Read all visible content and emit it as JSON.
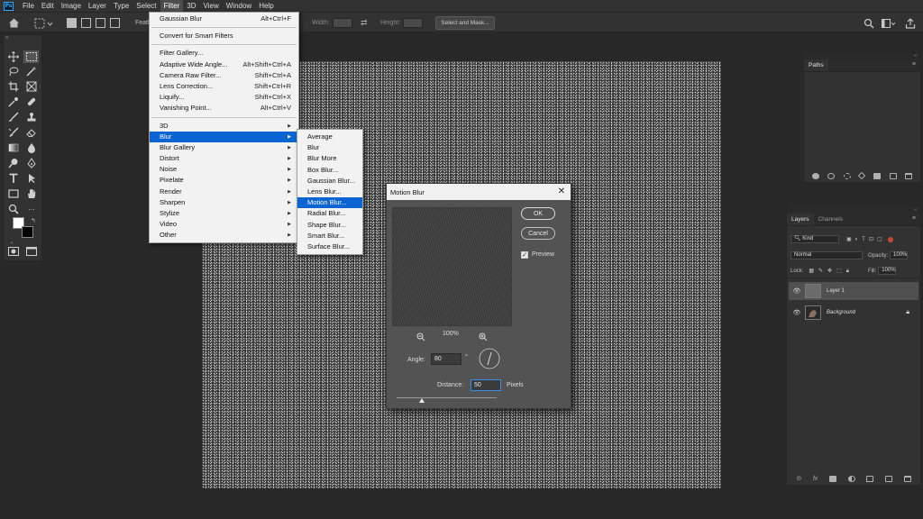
{
  "menubar": {
    "items": [
      "File",
      "Edit",
      "Image",
      "Layer",
      "Type",
      "Select",
      "Filter",
      "3D",
      "View",
      "Window",
      "Help"
    ],
    "active": "Filter",
    "logo_text": "Ps"
  },
  "options_bar": {
    "feather_label": "Feath",
    "width_label": "Width:",
    "height_label": "Height:",
    "select_mask_label": "Select and Mask..."
  },
  "filter_menu": {
    "items": [
      {
        "label": "Gaussian Blur",
        "shortcut": "Alt+Ctrl+F"
      },
      {
        "sep": true
      },
      {
        "label": "Convert for Smart Filters",
        "shortcut": ""
      },
      {
        "sep": true
      },
      {
        "label": "Filter Gallery...",
        "shortcut": ""
      },
      {
        "label": "Adaptive Wide Angle...",
        "shortcut": "Alt+Shift+Ctrl+A"
      },
      {
        "label": "Camera Raw Filter...",
        "shortcut": "Shift+Ctrl+A"
      },
      {
        "label": "Lens Correction...",
        "shortcut": "Shift+Ctrl+R"
      },
      {
        "label": "Liquify...",
        "shortcut": "Shift+Ctrl+X"
      },
      {
        "label": "Vanishing Point...",
        "shortcut": "Alt+Ctrl+V"
      },
      {
        "sep": true
      },
      {
        "label": "3D",
        "submenu": true
      },
      {
        "label": "Blur",
        "submenu": true,
        "highlight": true
      },
      {
        "label": "Blur Gallery",
        "submenu": true
      },
      {
        "label": "Distort",
        "submenu": true
      },
      {
        "label": "Noise",
        "submenu": true
      },
      {
        "label": "Pixelate",
        "submenu": true
      },
      {
        "label": "Render",
        "submenu": true
      },
      {
        "label": "Sharpen",
        "submenu": true
      },
      {
        "label": "Stylize",
        "submenu": true
      },
      {
        "label": "Video",
        "submenu": true
      },
      {
        "label": "Other",
        "submenu": true
      }
    ]
  },
  "blur_submenu": {
    "items": [
      {
        "label": "Average"
      },
      {
        "label": "Blur"
      },
      {
        "label": "Blur More"
      },
      {
        "label": "Box Blur..."
      },
      {
        "label": "Gaussian Blur..."
      },
      {
        "label": "Lens Blur..."
      },
      {
        "label": "Motion Blur...",
        "highlight": true
      },
      {
        "label": "Radial Blur..."
      },
      {
        "label": "Shape Blur..."
      },
      {
        "label": "Smart Blur..."
      },
      {
        "label": "Surface Blur..."
      }
    ]
  },
  "motion_blur_dialog": {
    "title": "Motion Blur",
    "ok_label": "OK",
    "cancel_label": "Cancel",
    "preview_label": "Preview",
    "preview_checked": true,
    "zoom": "100%",
    "angle_label": "Angle:",
    "angle_value": "80",
    "angle_unit": "°",
    "distance_label": "Distance:",
    "distance_value": "50",
    "distance_unit": "Pixels"
  },
  "paths_panel": {
    "tab": "Paths"
  },
  "layers_panel": {
    "tabs": [
      "Layers",
      "Channels"
    ],
    "filter_kind": "Kind",
    "blend_mode": "Normal",
    "opacity_label": "Opacity:",
    "opacity_value": "100%",
    "lock_label": "Lock:",
    "fill_label": "Fill:",
    "fill_value": "100%",
    "layers": [
      {
        "name": "Layer 1",
        "selected": true
      },
      {
        "name": "Background",
        "locked": true
      }
    ]
  },
  "colors": {
    "menu_highlight": "#0a64d2",
    "foreground": "#ffffff",
    "background": "#000000"
  }
}
